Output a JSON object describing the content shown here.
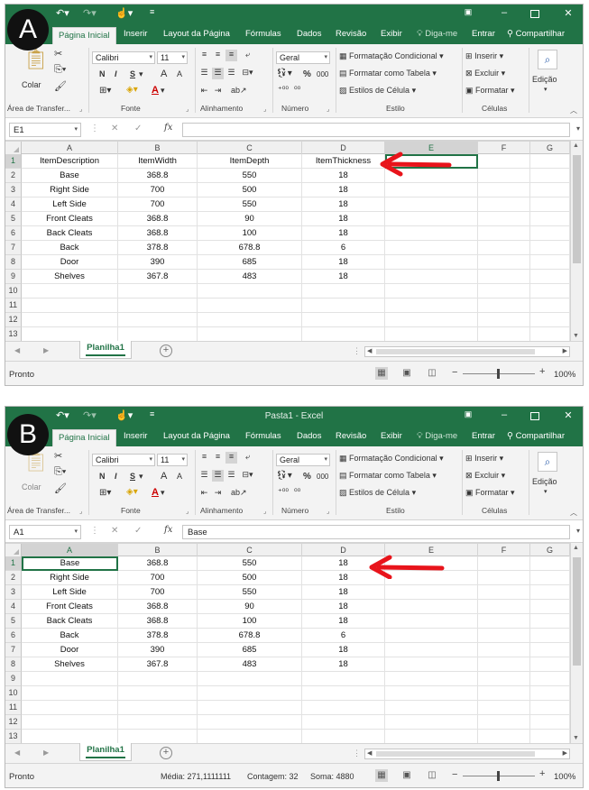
{
  "panels": {
    "a": {
      "badge": "A",
      "title": "",
      "name_box": "E1",
      "formula_value": "",
      "rows": [
        {
          "num": "1",
          "cells": [
            "ItemDescription",
            "ItemWidth",
            "ItemDepth",
            "ItemThickness"
          ]
        },
        {
          "num": "2",
          "cells": [
            "Base",
            "368.8",
            "550",
            "18"
          ]
        },
        {
          "num": "3",
          "cells": [
            "Right Side",
            "700",
            "500",
            "18"
          ]
        },
        {
          "num": "4",
          "cells": [
            "Left Side",
            "700",
            "550",
            "18"
          ]
        },
        {
          "num": "5",
          "cells": [
            "Front Cleats",
            "368.8",
            "90",
            "18"
          ]
        },
        {
          "num": "6",
          "cells": [
            "Back Cleats",
            "368.8",
            "100",
            "18"
          ]
        },
        {
          "num": "7",
          "cells": [
            "Back",
            "378.8",
            "678.8",
            "6"
          ]
        },
        {
          "num": "8",
          "cells": [
            "Door",
            "390",
            "685",
            "18"
          ]
        },
        {
          "num": "9",
          "cells": [
            "Shelves",
            "367.8",
            "483",
            "18"
          ]
        },
        {
          "num": "10",
          "cells": [
            "",
            "",
            "",
            ""
          ]
        },
        {
          "num": "11",
          "cells": [
            "",
            "",
            "",
            ""
          ]
        },
        {
          "num": "12",
          "cells": [
            "",
            "",
            "",
            ""
          ]
        },
        {
          "num": "13",
          "cells": [
            "",
            "",
            "",
            ""
          ]
        }
      ],
      "status_left": "Pronto",
      "aggregates": {
        "media": "",
        "contagem": "",
        "soma": ""
      }
    },
    "b": {
      "badge": "B",
      "title": "Pasta1 - Excel",
      "name_box": "A1",
      "formula_value": "Base",
      "rows": [
        {
          "num": "1",
          "cells": [
            "Base",
            "368.8",
            "550",
            "18"
          ]
        },
        {
          "num": "2",
          "cells": [
            "Right Side",
            "700",
            "500",
            "18"
          ]
        },
        {
          "num": "3",
          "cells": [
            "Left Side",
            "700",
            "550",
            "18"
          ]
        },
        {
          "num": "4",
          "cells": [
            "Front Cleats",
            "368.8",
            "90",
            "18"
          ]
        },
        {
          "num": "5",
          "cells": [
            "Back Cleats",
            "368.8",
            "100",
            "18"
          ]
        },
        {
          "num": "6",
          "cells": [
            "Back",
            "378.8",
            "678.8",
            "6"
          ]
        },
        {
          "num": "7",
          "cells": [
            "Door",
            "390",
            "685",
            "18"
          ]
        },
        {
          "num": "8",
          "cells": [
            "Shelves",
            "367.8",
            "483",
            "18"
          ]
        },
        {
          "num": "9",
          "cells": [
            "",
            "",
            "",
            ""
          ]
        },
        {
          "num": "10",
          "cells": [
            "",
            "",
            "",
            ""
          ]
        },
        {
          "num": "11",
          "cells": [
            "",
            "",
            "",
            ""
          ]
        },
        {
          "num": "12",
          "cells": [
            "",
            "",
            "",
            ""
          ]
        },
        {
          "num": "13",
          "cells": [
            "",
            "",
            "",
            ""
          ]
        }
      ],
      "status_left": "Pronto",
      "aggregates": {
        "media": "Média: 271,1111111",
        "contagem": "Contagem: 32",
        "soma": "Soma: 4880"
      }
    }
  },
  "tabs": {
    "home": "Página Inicial",
    "insert": "Inserir",
    "layout": "Layout da Página",
    "formulas": "Fórmulas",
    "data": "Dados",
    "review": "Revisão",
    "view": "Exibir",
    "tell_me": "Diga-me",
    "sign_in": "Entrar",
    "share": "Compartilhar"
  },
  "ribbon": {
    "paste_label": "Colar",
    "clipboard_group": "Área de Transfer...",
    "font_name": "Calibri",
    "font_size": "11",
    "bold": "N",
    "italic": "I",
    "underline": "S",
    "grow_font": "A",
    "shrink_font": "A",
    "font_color_glyph": "A",
    "font_group": "Fonte",
    "alignment_group": "Alinhamento",
    "number_format": "Geral",
    "percent": "%",
    "thousands": "000",
    "dec_inc": "⁺⁰⁰",
    "dec_dec": "⁰⁰",
    "number_group": "Número",
    "conditional_formatting": "Formatação Condicional",
    "format_as_table": "Formatar como Tabela",
    "cell_styles": "Estilos de Célula",
    "styles_group": "Estilo",
    "insert_cells": "Inserir",
    "delete_cells": "Excluir",
    "format_cells": "Formatar",
    "cells_group": "Células",
    "editing": "Edição"
  },
  "columns": [
    "A",
    "B",
    "C",
    "D",
    "E",
    "F",
    "G"
  ],
  "sheet_tab": "Planilha1",
  "zoom": "100%",
  "fx": "fx",
  "colors": {
    "excel_green": "#217346",
    "arrow_red": "#e8141b"
  },
  "icons": [
    "undo-icon",
    "redo-icon",
    "touch-mode-icon",
    "customize-icon",
    "ribbon-options-icon",
    "minimize-icon",
    "maximize-icon",
    "close-icon",
    "search-icon",
    "lightbulb-icon",
    "person-icon",
    "scissors-icon",
    "copy-icon",
    "format-painter-icon",
    "paste-icon"
  ]
}
